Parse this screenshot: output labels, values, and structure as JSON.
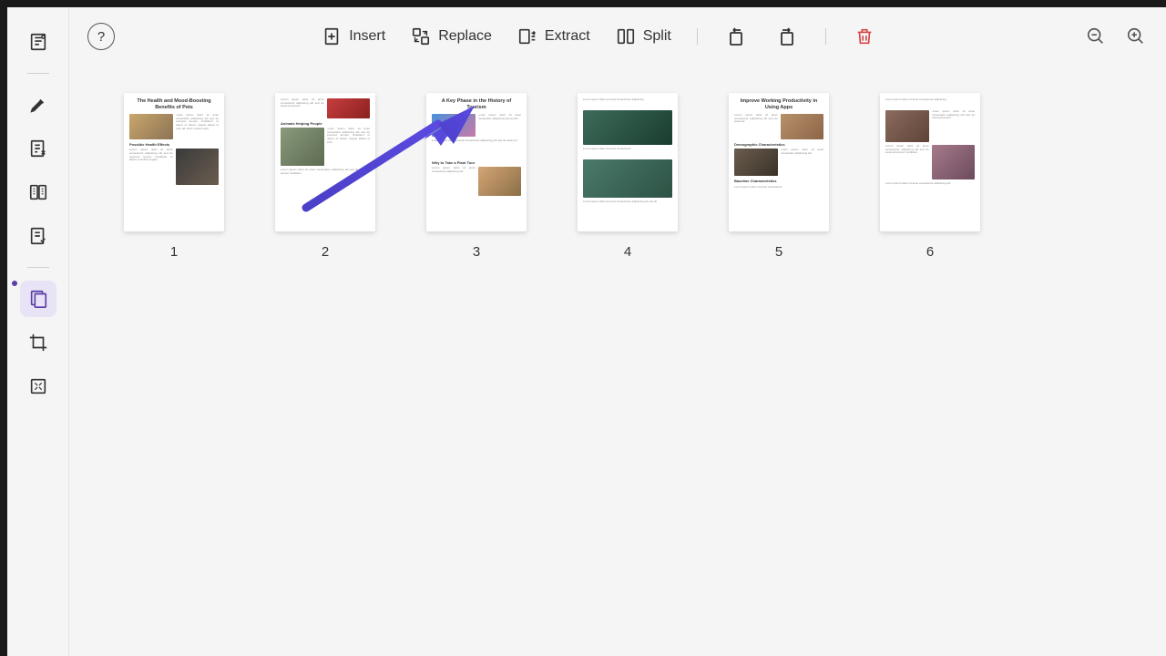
{
  "toolbar": {
    "insert": "Insert",
    "replace": "Replace",
    "extract": "Extract",
    "split": "Split"
  },
  "pages": [
    {
      "num": "1",
      "title": "The Health and Mood-Boosting Benefits of Pets",
      "sub1": "Possible Health Effects"
    },
    {
      "num": "2",
      "title": "",
      "sub1": "Animals Helping People"
    },
    {
      "num": "3",
      "title": "A Key Phase in the History of Tourism",
      "sub1": "Why to Take a Plant Tour"
    },
    {
      "num": "4",
      "title": "",
      "sub1": ""
    },
    {
      "num": "5",
      "title": "Improve Working Productivity in Using Apps",
      "sub1": "Demographic Characteristics",
      "sub2": "Baseline Characteristics"
    },
    {
      "num": "6",
      "title": "",
      "sub1": ""
    }
  ],
  "help": "?"
}
